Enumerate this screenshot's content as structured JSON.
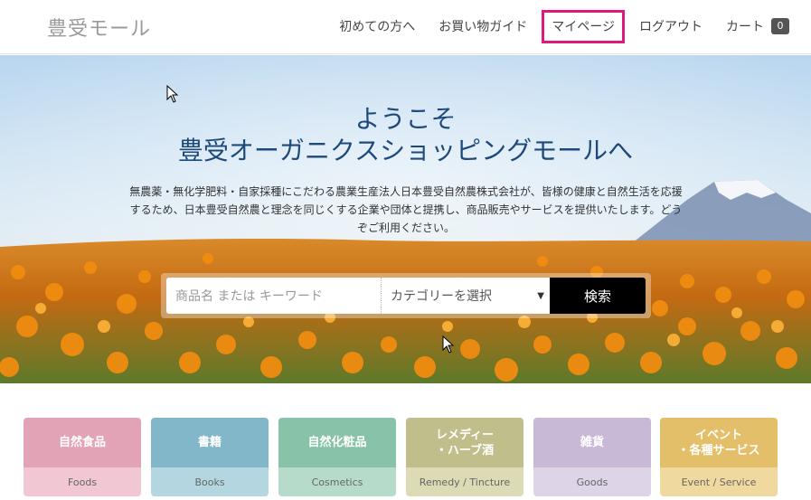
{
  "header": {
    "logo": "豊受モール",
    "nav": [
      {
        "label": "初めての方へ"
      },
      {
        "label": "お買い物ガイド"
      },
      {
        "label": "マイページ"
      },
      {
        "label": "ログアウト"
      }
    ],
    "cart": {
      "label": "カート",
      "count": "0"
    }
  },
  "hero": {
    "title_line1": "ようこそ",
    "title_line2": "豊受オーガニクスショッピングモールへ",
    "description": "無農薬・無化学肥料・自家採種にこだわる農業生産法人日本豊受自然農株式会社が、皆様の健康と自然生活を応援するため、日本豊受自然農と理念を同じくする企業や団体と提携し、商品販売やサービスを提供いたします。どうぞご利用ください。",
    "search": {
      "placeholder": "商品名 または キーワード",
      "category_select": "カテゴリーを選択",
      "button": "検索"
    }
  },
  "categories": [
    {
      "label": "自然食品",
      "sub": "Foods",
      "color_top": "#e3a3b6",
      "color_bottom": "#f0c7d3"
    },
    {
      "label": "書籍",
      "sub": "Books",
      "color_top": "#82b7c9",
      "color_bottom": "#b4d6e1"
    },
    {
      "label": "自然化粧品",
      "sub": "Cosmetics",
      "color_top": "#88c2a8",
      "color_bottom": "#b6dbca"
    },
    {
      "label": "レメディー\n・ハーブ酒",
      "sub": "Remedy / Tincture",
      "color_top": "#c0bf8b",
      "color_bottom": "#dcdbb5"
    },
    {
      "label": "雑貨",
      "sub": "Goods",
      "color_top": "#c8b9d7",
      "color_bottom": "#ded4e8"
    },
    {
      "label": "イベント\n・各種サービス",
      "sub": "Event / Service",
      "color_top": "#e3bf6a",
      "color_bottom": "#f0d99f"
    }
  ]
}
